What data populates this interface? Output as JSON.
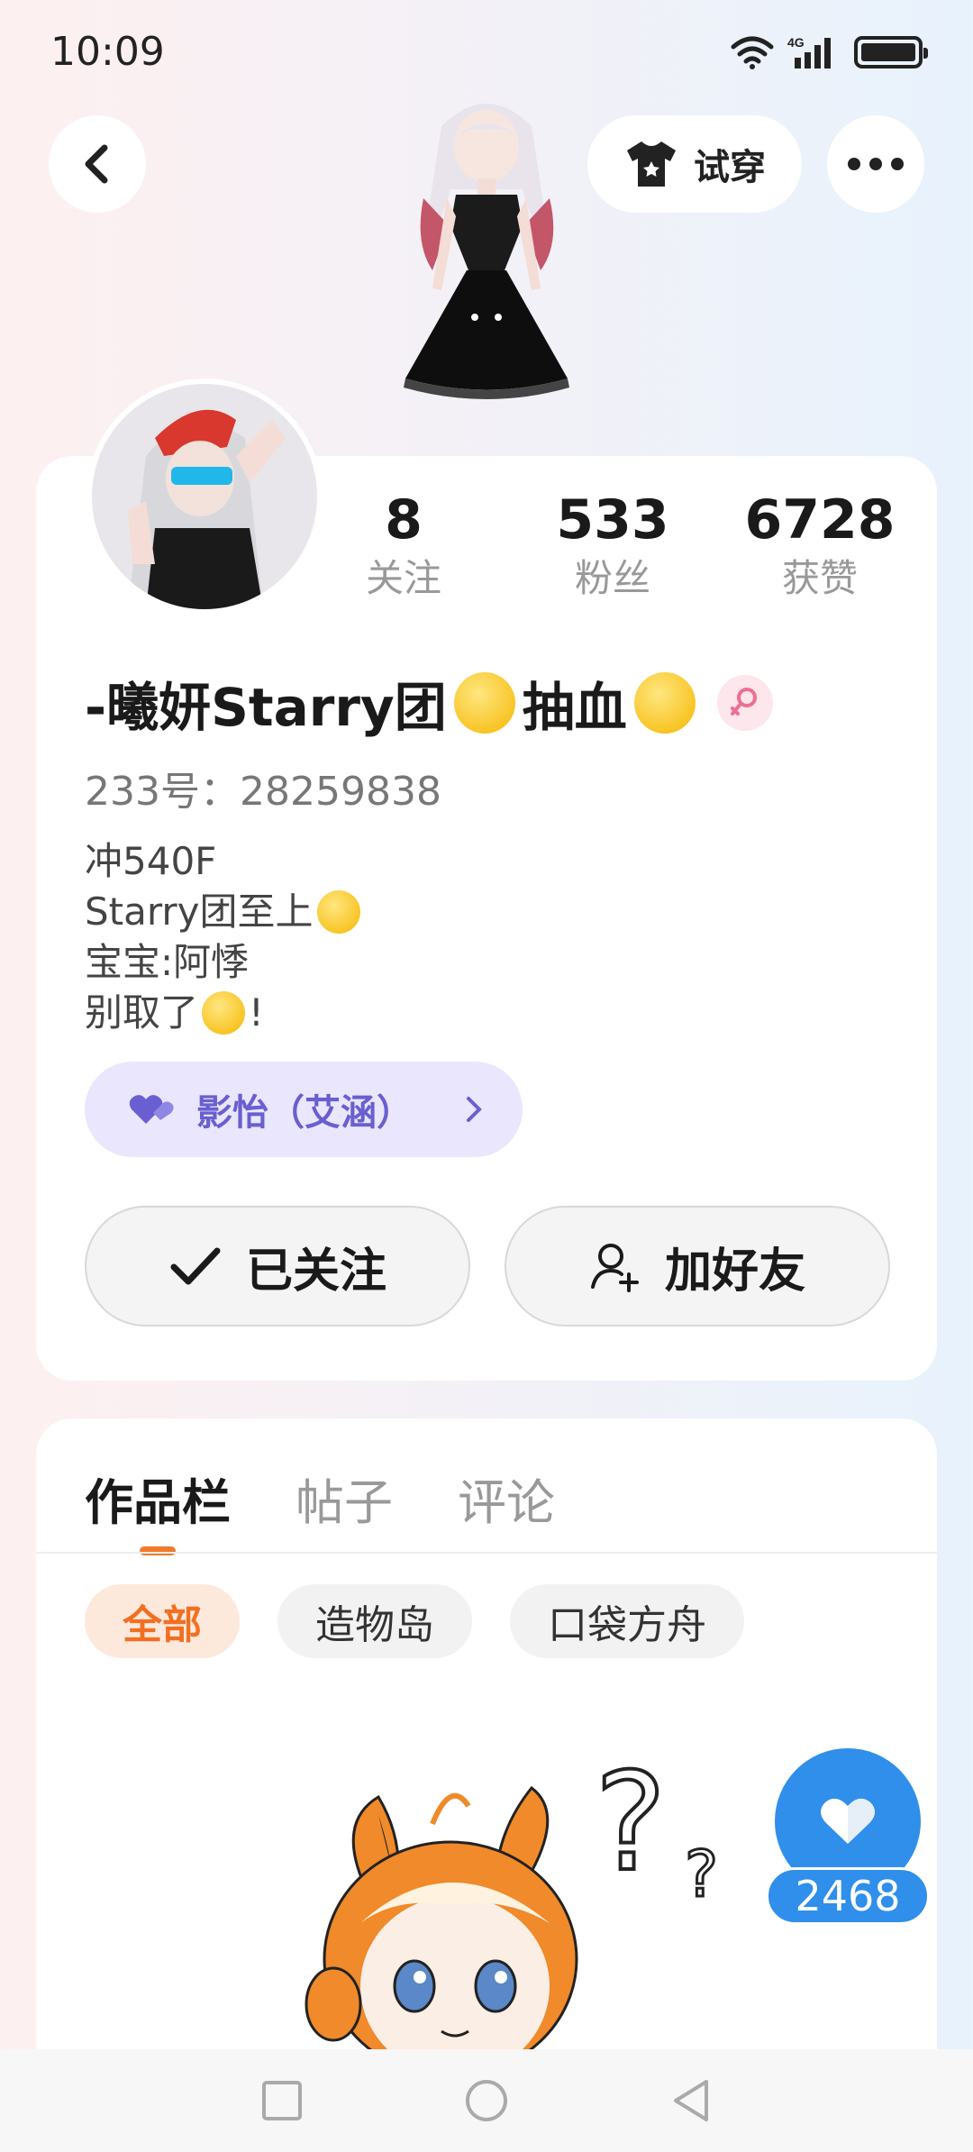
{
  "status_bar": {
    "time": "10:09",
    "network": "4G"
  },
  "header": {
    "try_on_label": "试穿"
  },
  "stats": [
    {
      "value": "8",
      "label": "关注"
    },
    {
      "value": "533",
      "label": "粉丝"
    },
    {
      "value": "6728",
      "label": "获赞"
    }
  ],
  "profile": {
    "name_part1": "-曦妍Starry团",
    "name_part2": "抽血",
    "uid": "233号：28259838",
    "bio": [
      "冲540F",
      "Starry团至上",
      "宝宝:阿悸",
      "别取了"
    ],
    "bio_last_suffix": "!",
    "relation_label": "影怡（艾涵）"
  },
  "actions": {
    "followed_label": "已关注",
    "add_friend_label": "加好友"
  },
  "tabs": [
    "作品栏",
    "帖子",
    "评论"
  ],
  "filters": [
    "全部",
    "造物岛",
    "口袋方舟"
  ],
  "like": {
    "count": "2468"
  },
  "colors": {
    "accent_orange": "#f26f22",
    "like_blue": "#2f8fea",
    "relation_purple": "#6a5fd0"
  }
}
